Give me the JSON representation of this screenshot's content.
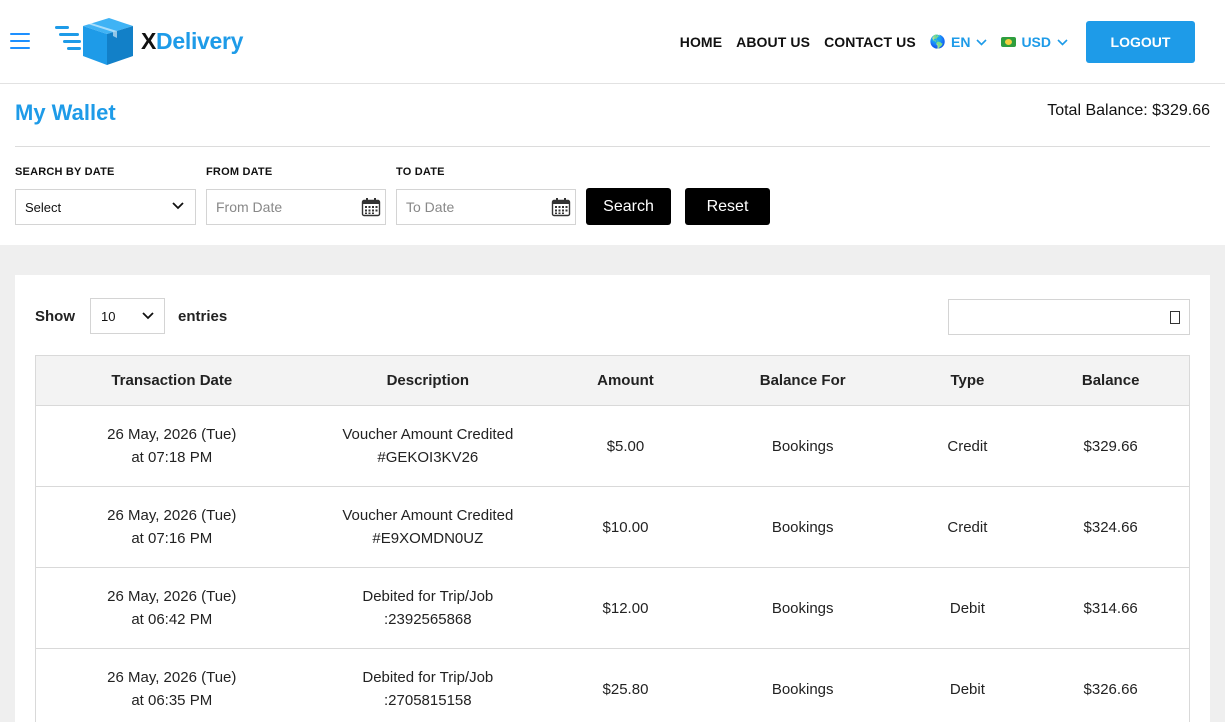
{
  "header": {
    "logo_x": "X",
    "logo_rest": "Delivery",
    "nav": [
      "HOME",
      "ABOUT US",
      "CONTACT US"
    ],
    "language": "EN",
    "currency": "USD",
    "logout_label": "LOGOUT"
  },
  "page": {
    "title": "My Wallet",
    "total_balance": "Total Balance: $329.66"
  },
  "filters": {
    "search_by_date_label": "SEARCH BY DATE",
    "search_by_date_value": "Select",
    "from_date_label": "FROM DATE",
    "from_date_placeholder": "From Date",
    "to_date_label": "TO DATE",
    "to_date_placeholder": "To Date",
    "search_label": "Search",
    "reset_label": "Reset"
  },
  "table_controls": {
    "show_label": "Show",
    "entries_value": "10",
    "entries_label": "entries"
  },
  "table": {
    "columns": [
      "Transaction Date",
      "Description",
      "Amount",
      "Balance For",
      "Type",
      "Balance"
    ],
    "rows": [
      {
        "date": "26 May, 2026 (Tue)",
        "time": "at 07:18 PM",
        "desc1": "Voucher Amount Credited",
        "desc2": "#GEKOI3KV26",
        "amount": "$5.00",
        "balance_for": "Bookings",
        "type": "Credit",
        "balance": "$329.66"
      },
      {
        "date": "26 May, 2026 (Tue)",
        "time": "at 07:16 PM",
        "desc1": "Voucher Amount Credited",
        "desc2": "#E9XOMDN0UZ",
        "amount": "$10.00",
        "balance_for": "Bookings",
        "type": "Credit",
        "balance": "$324.66"
      },
      {
        "date": "26 May, 2026 (Tue)",
        "time": "at 06:42 PM",
        "desc1": "Debited for Trip/Job",
        "desc2": ":2392565868",
        "amount": "$12.00",
        "balance_for": "Bookings",
        "type": "Debit",
        "balance": "$314.66"
      },
      {
        "date": "26 May, 2026 (Tue)",
        "time": "at 06:35 PM",
        "desc1": "Debited for Trip/Job",
        "desc2": ":2705815158",
        "amount": "$25.80",
        "balance_for": "Bookings",
        "type": "Debit",
        "balance": "$326.66"
      }
    ]
  },
  "colors": {
    "accent": "#1e9be8",
    "dark_button": "#000000",
    "content_bg": "#efefef"
  }
}
